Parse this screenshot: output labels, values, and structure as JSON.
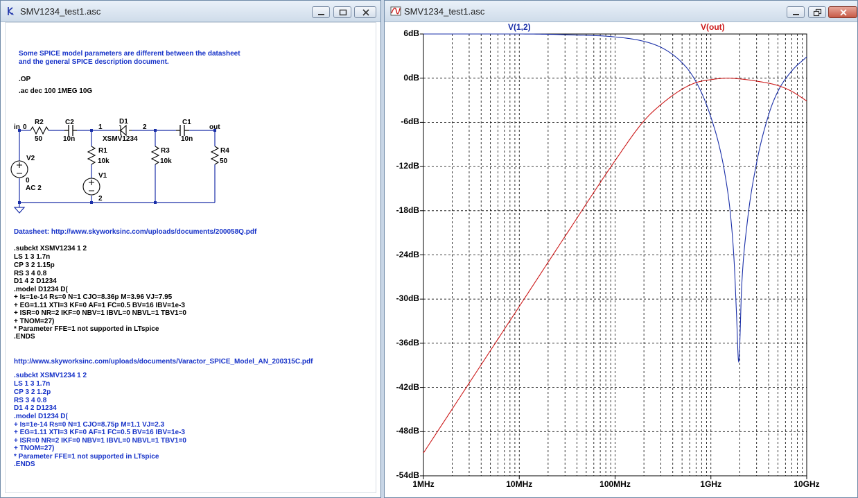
{
  "windows": {
    "schematic": {
      "title": "SMV1234_test1.asc"
    },
    "plot": {
      "title": "SMV1234_test1.asc"
    }
  },
  "colors": {
    "blue_text": "#1632c8",
    "wire": "#1a2fa8",
    "trace_v12": "#1a2fa8",
    "trace_vout": "#cc1a1a"
  },
  "schematic": {
    "comment": [
      "Some SPICE model parameters are different between the datasheet",
      "and the general SPICE description document."
    ],
    "directives": [
      ".OP",
      ".ac dec 100 1MEG 10G"
    ],
    "labels": {
      "in": "in",
      "zero": "0",
      "node1": "1",
      "node2": "2",
      "out": "out",
      "gnd2": "2",
      "R2": "R2",
      "R2v": "50",
      "C2": "C2",
      "C2v": "10n",
      "D1": "D1",
      "D1v": "XSMV1234",
      "C1": "C1",
      "C1v": "10n",
      "R1": "R1",
      "R1v": "10k",
      "R3": "R3",
      "R3v": "10k",
      "R4": "R4",
      "R4v": "50",
      "V1": "V1",
      "V2": "V2",
      "V2a": "0",
      "V2b": "AC 2"
    },
    "datasheet_link": "Datasheet: http://www.skyworksinc.com/uploads/documents/200058Q.pdf",
    "model1": [
      ".subckt  XSMV1234 1 2",
      "LS 1 3 1.7n",
      "CP 3 2 1.15p",
      "RS 3 4 0.8",
      "D1 4 2 D1234",
      ".model D1234 D(",
      "+ Is=1e-14 Rs=0 N=1 CJO=8.36p M=3.96 VJ=7.95",
      "+ EG=1.11 XTI=3 KF=0 AF=1 FC=0.5 BV=16 IBV=1e-3",
      "+ ISR=0 NR=2 IKF=0 NBV=1 IBVL=0 NBVL=1 TBV1=0",
      "+ TNOM=27)",
      "* Parameter FFE=1 not supported in LTspice",
      ".ENDS"
    ],
    "an_link": "http://www.skyworksinc.com/uploads/documents/Varactor_SPICE_Model_AN_200315C.pdf",
    "model2": [
      ".subckt  XSMV1234 1 2",
      "LS 1 3 1.7n",
      "CP 3 2 1.2p",
      "RS 3 4 0.8",
      "D1 4 2 D1234",
      ".model D1234 D(",
      "+ Is=1e-14 Rs=0 N=1 CJO=8.75p M=1.1 VJ=2.3",
      "+ EG=1.11 XTI=3 KF=0 AF=1 FC=0.5 BV=16 IBV=1e-3",
      "+ ISR=0 NR=2 IKF=0 NBV=1 IBVL=0 NBVL=1 TBV1=0",
      "+ TNOM=27)",
      "* Parameter FFE=1 not supported in LTspice",
      ".ENDS"
    ]
  },
  "chart_data": {
    "type": "line",
    "x_scale": "log",
    "xlim": [
      1000000,
      10000000000
    ],
    "ylim": [
      -54,
      6
    ],
    "grid": true,
    "xticks": [
      {
        "value": 1000000,
        "label": "1MHz"
      },
      {
        "value": 10000000,
        "label": "10MHz"
      },
      {
        "value": 100000000,
        "label": "100MHz"
      },
      {
        "value": 1000000000,
        "label": "1GHz"
      },
      {
        "value": 10000000000,
        "label": "10GHz"
      }
    ],
    "yticks": [
      {
        "value": 6,
        "label": "6dB"
      },
      {
        "value": 0,
        "label": "0dB"
      },
      {
        "value": -6,
        "label": "-6dB"
      },
      {
        "value": -12,
        "label": "-12dB"
      },
      {
        "value": -18,
        "label": "-18dB"
      },
      {
        "value": -24,
        "label": "-24dB"
      },
      {
        "value": -30,
        "label": "-30dB"
      },
      {
        "value": -36,
        "label": "-36dB"
      },
      {
        "value": -42,
        "label": "-42dB"
      },
      {
        "value": -48,
        "label": "-48dB"
      },
      {
        "value": -54,
        "label": "-54dB"
      }
    ],
    "series": [
      {
        "name": "V(1,2)",
        "color": "#1a2fa8",
        "x": [
          1000000,
          10000000,
          30000000,
          100000000,
          200000000,
          300000000,
          400000000,
          500000000,
          600000000,
          700000000,
          800000000,
          900000000,
          1000000000,
          1200000000,
          1400000000,
          1600000000,
          1750000000,
          1850000000,
          1950000000,
          2100000000,
          2400000000,
          3000000000,
          4000000000,
          5000000000,
          7000000000,
          10000000000
        ],
        "y": [
          6.0,
          6.0,
          5.9,
          5.6,
          5.0,
          4.2,
          3.2,
          2.1,
          0.9,
          -0.5,
          -2.0,
          -3.6,
          -5.3,
          -8.8,
          -13.0,
          -18.5,
          -25.0,
          -32.0,
          -38.5,
          -28.0,
          -19.5,
          -11.5,
          -5.0,
          -1.8,
          1.0,
          2.9
        ]
      },
      {
        "name": "V(out)",
        "color": "#cc1a1a",
        "x": [
          1000000,
          10000000,
          30000000,
          100000000,
          200000000,
          300000000,
          500000000,
          700000000,
          1000000000,
          1500000000,
          2000000000,
          3000000000,
          5000000000,
          7000000000,
          10000000000
        ],
        "y": [
          -50.9,
          -31.0,
          -21.5,
          -11.2,
          -5.8,
          -3.6,
          -1.5,
          -0.6,
          -0.2,
          0.0,
          -0.1,
          -0.4,
          -1.0,
          -1.8,
          -3.1
        ]
      }
    ]
  }
}
